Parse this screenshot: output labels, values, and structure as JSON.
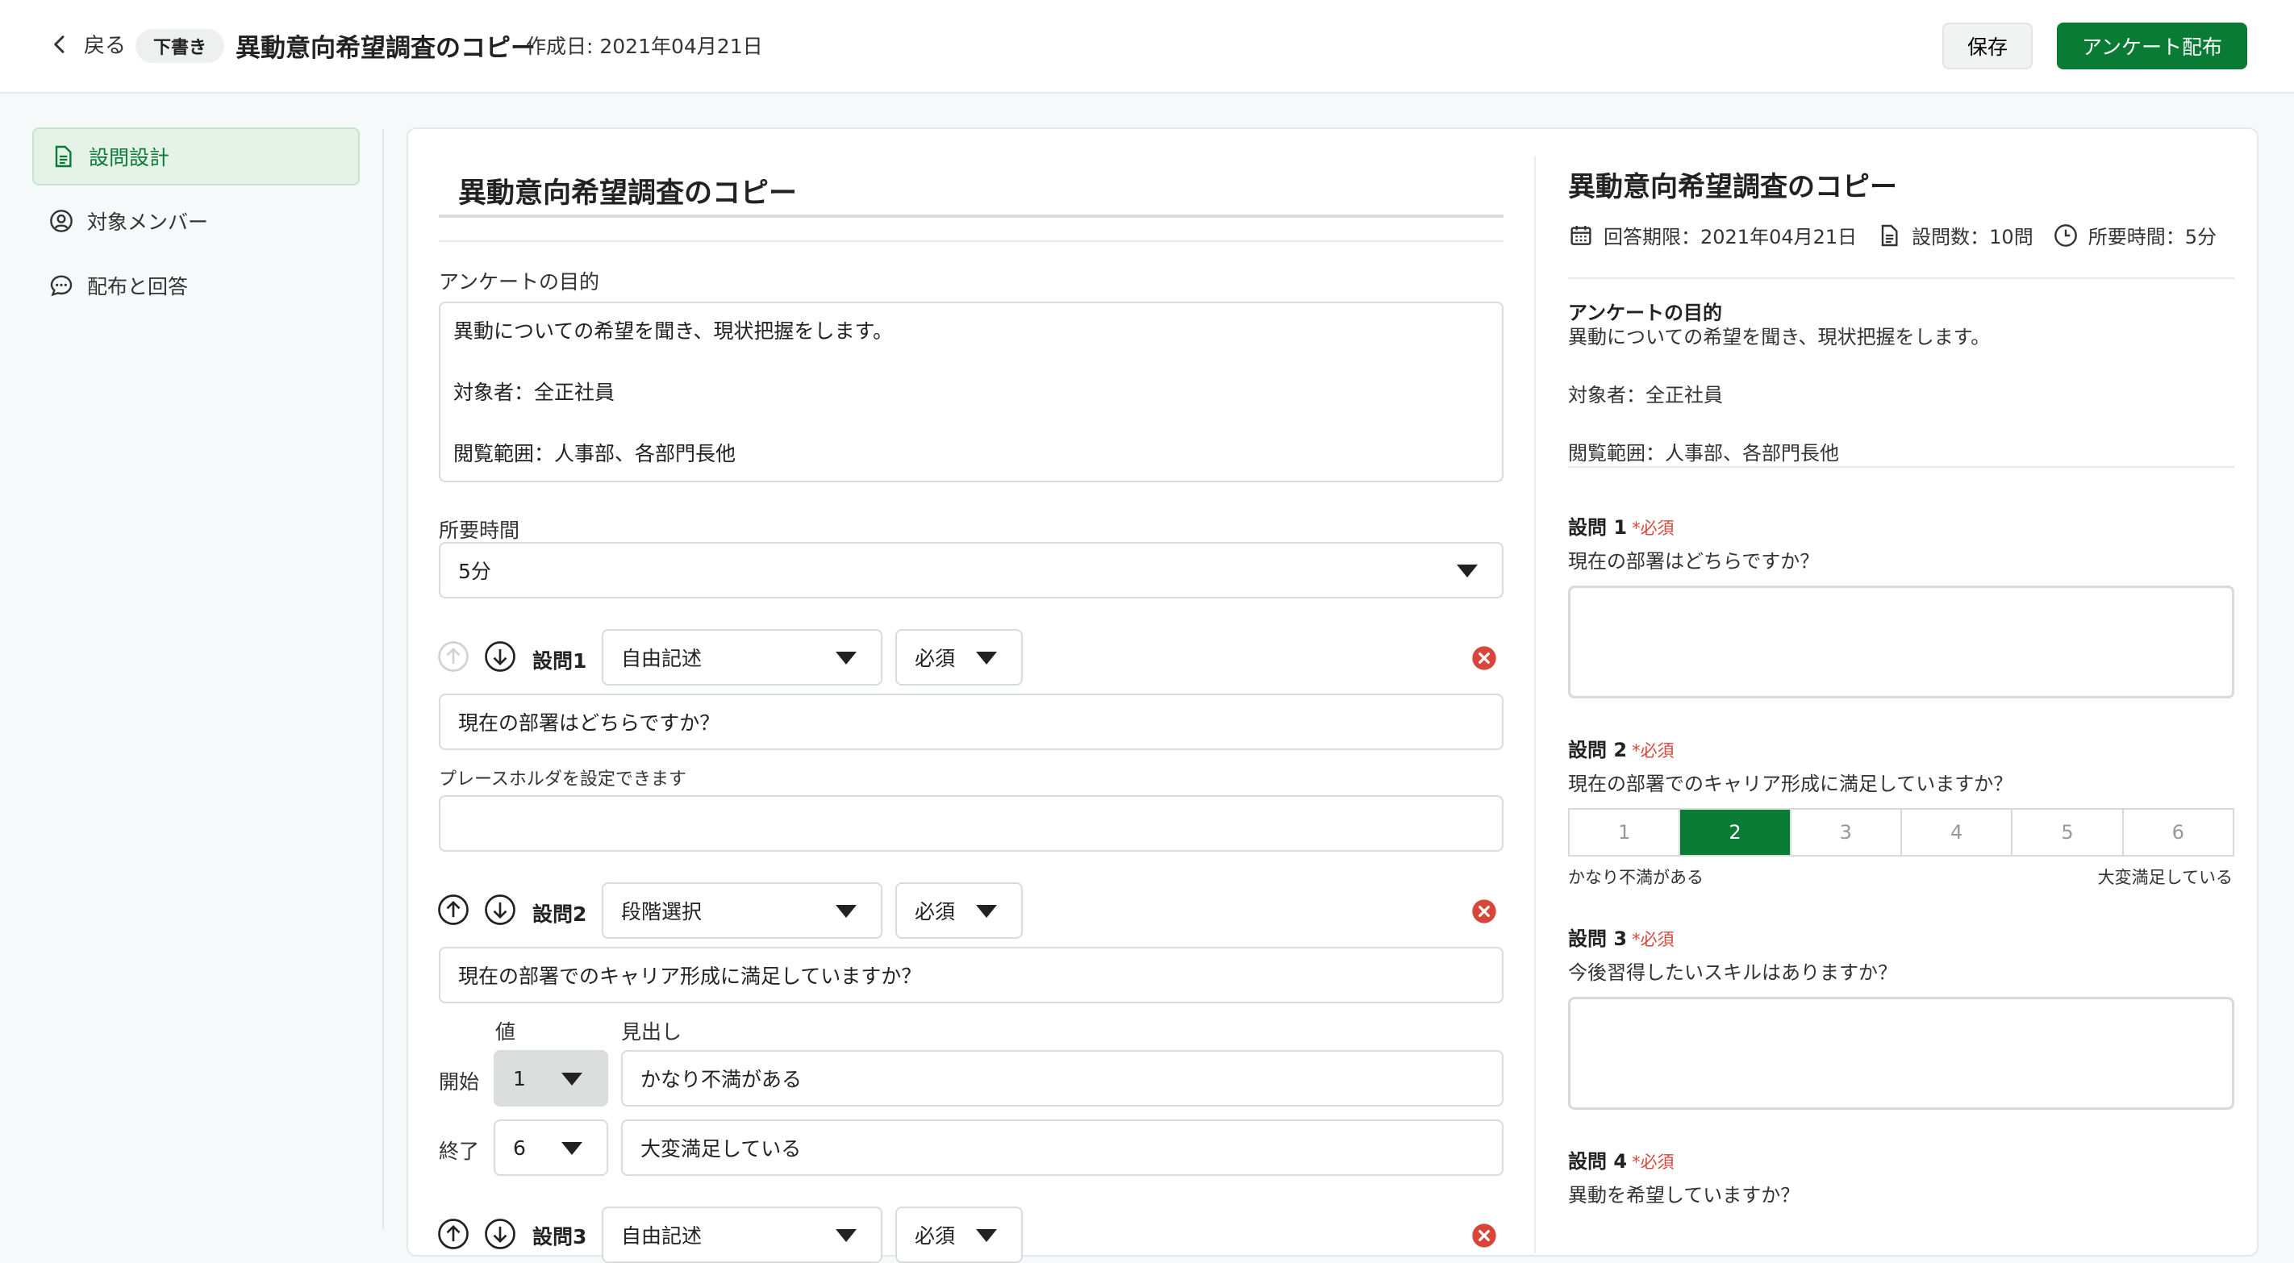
{
  "header": {
    "back_label": "戻る",
    "status_badge": "下書き",
    "title": "異動意向希望調査のコピー",
    "created": "作成日: 2021年04月21日",
    "save_label": "保存",
    "publish_label": "アンケート配布"
  },
  "sidebar": {
    "items": [
      {
        "label": "設問設計",
        "icon": "document-icon",
        "active": true
      },
      {
        "label": "対象メンバー",
        "icon": "user-circle-icon",
        "active": false
      },
      {
        "label": "配布と回答",
        "icon": "chat-bubble-icon",
        "active": false
      }
    ]
  },
  "editor": {
    "title_value": "異動意向希望調査のコピー",
    "purpose_label": "アンケートの目的",
    "purpose_value": "異動についての希望を聞き、現状把握をします。\n\n対象者：全正社員\n\n閲覧範囲：人事部、各部門長他",
    "duration_label": "所要時間",
    "duration_value": "5分",
    "questions": [
      {
        "label": "設問1",
        "type": "自由記述",
        "required": "必須",
        "text": "現在の部署はどちらですか？",
        "placeholder_label": "プレースホルダを設定できます",
        "placeholder_value": ""
      },
      {
        "label": "設問2",
        "type": "段階選択",
        "required": "必須",
        "text": "現在の部署でのキャリア形成に満足していますか？",
        "value_header": "値",
        "caption_header": "見出し",
        "start_label": "開始",
        "start_value": "1",
        "start_caption": "かなり不満がある",
        "end_label": "終了",
        "end_value": "6",
        "end_caption": "大変満足している"
      },
      {
        "label": "設問3",
        "type": "自由記述",
        "required": "必須"
      }
    ]
  },
  "preview": {
    "title": "異動意向希望調査のコピー",
    "deadline": "回答期限：2021年04月21日",
    "question_count": "設問数：10問",
    "duration": "所要時間：5分",
    "purpose_heading": "アンケートの目的",
    "purpose_text": "異動についての希望を聞き、現状把握をします。\n\n対象者：全正社員\n\n閲覧範囲：人事部、各部門長他",
    "required_mark": "*必須",
    "questions": [
      {
        "label": "設問 1",
        "text": "現在の部署はどちらですか？"
      },
      {
        "label": "設問 2",
        "text": "現在の部署でのキャリア形成に満足していますか？",
        "scale": [
          "1",
          "2",
          "3",
          "4",
          "5",
          "6"
        ],
        "selected": 2,
        "low": "かなり不満がある",
        "high": "大変満足している"
      },
      {
        "label": "設問 3",
        "text": "今後習得したいスキルはありますか？"
      },
      {
        "label": "設問 4",
        "text": "異動を希望していますか？"
      }
    ]
  },
  "colors": {
    "brand_green": "#0a7b34",
    "required_red": "#d8463a",
    "delete_red": "#d8463a"
  }
}
